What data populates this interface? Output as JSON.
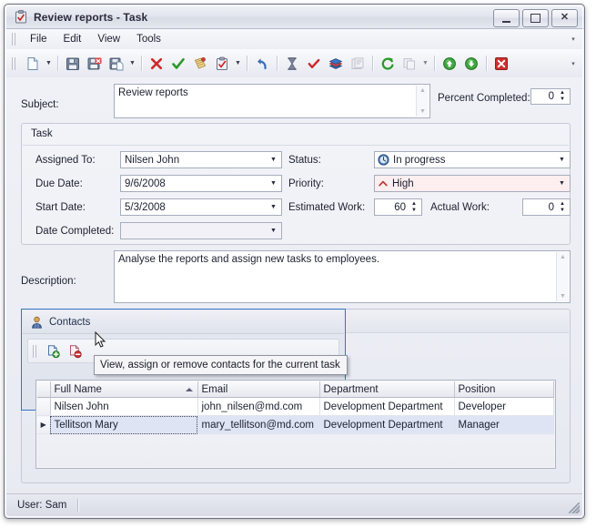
{
  "window": {
    "title": "Review reports - Task",
    "icon": "task-clipboard-icon",
    "buttons": {
      "minimize": "_",
      "maximize": "□",
      "close": "X"
    }
  },
  "menubar": {
    "items": [
      {
        "label": "File",
        "name": "menu-file"
      },
      {
        "label": "Edit",
        "name": "menu-edit"
      },
      {
        "label": "View",
        "name": "menu-view"
      },
      {
        "label": "Tools",
        "name": "menu-tools"
      }
    ],
    "overflow": "▾"
  },
  "toolbar": {
    "items": [
      {
        "name": "new-icon",
        "type": "icon"
      },
      {
        "name": "new-dropdown-arrow-icon",
        "type": "arrow"
      },
      {
        "name": "separator",
        "type": "sep"
      },
      {
        "name": "save-icon",
        "type": "icon"
      },
      {
        "name": "save-and-close-icon",
        "type": "icon"
      },
      {
        "name": "save-and-new-icon",
        "type": "icon"
      },
      {
        "name": "save-dropdown-arrow-icon",
        "type": "arrow"
      },
      {
        "name": "separator",
        "type": "sep"
      },
      {
        "name": "delete-icon",
        "type": "icon"
      },
      {
        "name": "mark-complete-icon",
        "type": "icon"
      },
      {
        "name": "note-icon",
        "type": "icon"
      },
      {
        "name": "task-icon",
        "type": "icon"
      },
      {
        "name": "task-dropdown-arrow-icon",
        "type": "arrow"
      },
      {
        "name": "separator",
        "type": "sep"
      },
      {
        "name": "undo-icon",
        "type": "icon"
      },
      {
        "name": "separator",
        "type": "sep"
      },
      {
        "name": "hourglass-icon",
        "type": "icon"
      },
      {
        "name": "check-icon",
        "type": "icon"
      },
      {
        "name": "books-icon",
        "type": "icon"
      },
      {
        "name": "report-icon",
        "type": "icon"
      },
      {
        "name": "separator",
        "type": "sep"
      },
      {
        "name": "refresh-icon",
        "type": "icon"
      },
      {
        "name": "copy-icon",
        "type": "icon"
      },
      {
        "name": "copy-dropdown-arrow-icon",
        "type": "arrow"
      },
      {
        "name": "separator",
        "type": "sep"
      },
      {
        "name": "move-up-icon",
        "type": "icon"
      },
      {
        "name": "move-down-icon",
        "type": "icon"
      },
      {
        "name": "separator",
        "type": "sep"
      },
      {
        "name": "cancel-icon",
        "type": "icon"
      }
    ],
    "overflow": "▾"
  },
  "form": {
    "subject": {
      "label": "Subject:",
      "value": "Review reports"
    },
    "percent_completed": {
      "label": "Percent Completed:",
      "value": "0"
    },
    "task_group": {
      "title": "Task"
    },
    "assigned_to": {
      "label": "Assigned To:",
      "value": "Nilsen John"
    },
    "status": {
      "label": "Status:",
      "value": "In progress",
      "icon": "clock-icon"
    },
    "due_date": {
      "label": "Due Date:",
      "value": "9/6/2008"
    },
    "priority": {
      "label": "Priority:",
      "value": "High",
      "icon": "priority-high-arrow-icon",
      "highlight_color": "#fdeef0"
    },
    "start_date": {
      "label": "Start Date:",
      "value": "5/3/2008"
    },
    "estimated_work": {
      "label": "Estimated Work:",
      "value": "60"
    },
    "actual_work": {
      "label": "Actual Work:",
      "value": "0"
    },
    "date_completed": {
      "label": "Date Completed:",
      "value": ""
    },
    "description": {
      "label": "Description:",
      "value": "Analyse the reports and assign new tasks to employees."
    }
  },
  "contacts": {
    "panel_title": "Contacts",
    "panel_icon": "contact-person-icon",
    "buttons": [
      {
        "name": "assign-contact-button",
        "icon": "add-contact-icon"
      },
      {
        "name": "remove-contact-button",
        "icon": "remove-contact-icon"
      }
    ],
    "tooltip": "View, assign or remove contacts for the current task",
    "grid": {
      "columns": [
        "Full Name",
        "Email",
        "Department",
        "Position"
      ],
      "sorted_column": "Full Name",
      "sort_direction": "asc",
      "rows": [
        {
          "selected": false,
          "indicator": "",
          "cells": [
            "Nilsen John",
            "john_nilsen@md.com",
            "Development Department",
            "Developer"
          ]
        },
        {
          "selected": true,
          "indicator": "▶",
          "cells": [
            "Tellitson Mary",
            "mary_tellitson@md.com",
            "Development Department",
            "Manager"
          ]
        }
      ]
    }
  },
  "statusbar": {
    "user": "User: Sam"
  }
}
